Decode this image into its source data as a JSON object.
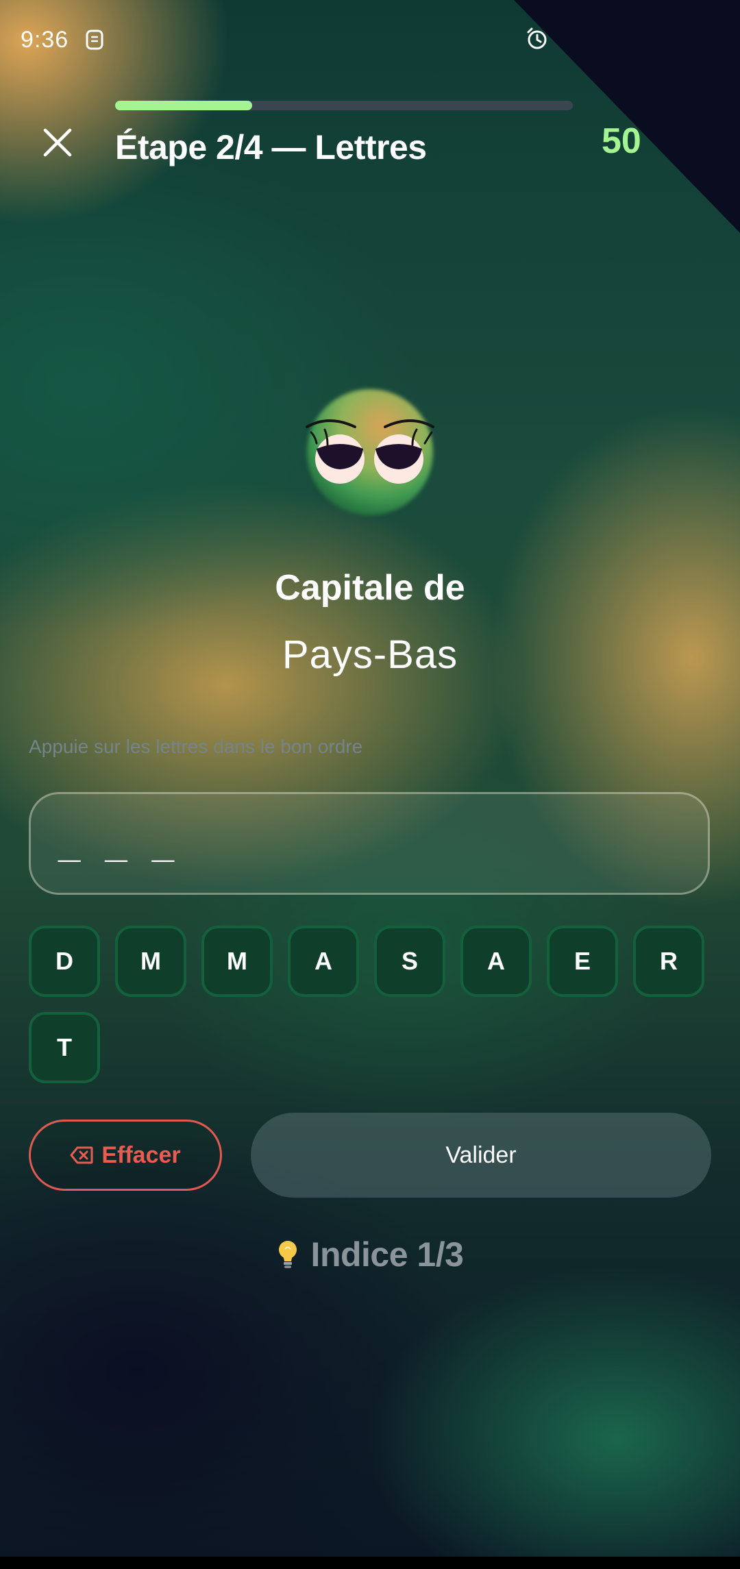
{
  "status_bar": {
    "time": "9:36",
    "icons": [
      "sim-icon",
      "alarm-icon"
    ]
  },
  "header": {
    "progress": 0.3,
    "title": "Étape 2/4 — Lettres",
    "score": "50 ",
    "close_icon": "close-icon"
  },
  "question": {
    "label": "Capitale de",
    "country": "Pays-Bas"
  },
  "instruction": "Appuie sur les lettres dans le bon ordre",
  "answer": {
    "value": "_ _ _"
  },
  "letters": [
    "D",
    "M",
    "M",
    "A",
    "S",
    "A",
    "E",
    "R",
    "T"
  ],
  "buttons": {
    "erase": "Effacer",
    "validate": "Valider"
  },
  "hint": {
    "label": "Indice 1/3",
    "icon": "lightbulb-icon"
  },
  "colors": {
    "accent_green": "#a4f592",
    "erase_red": "#e05a52",
    "tile_border": "#14603c",
    "tile_fill": "#0f3f2b"
  }
}
